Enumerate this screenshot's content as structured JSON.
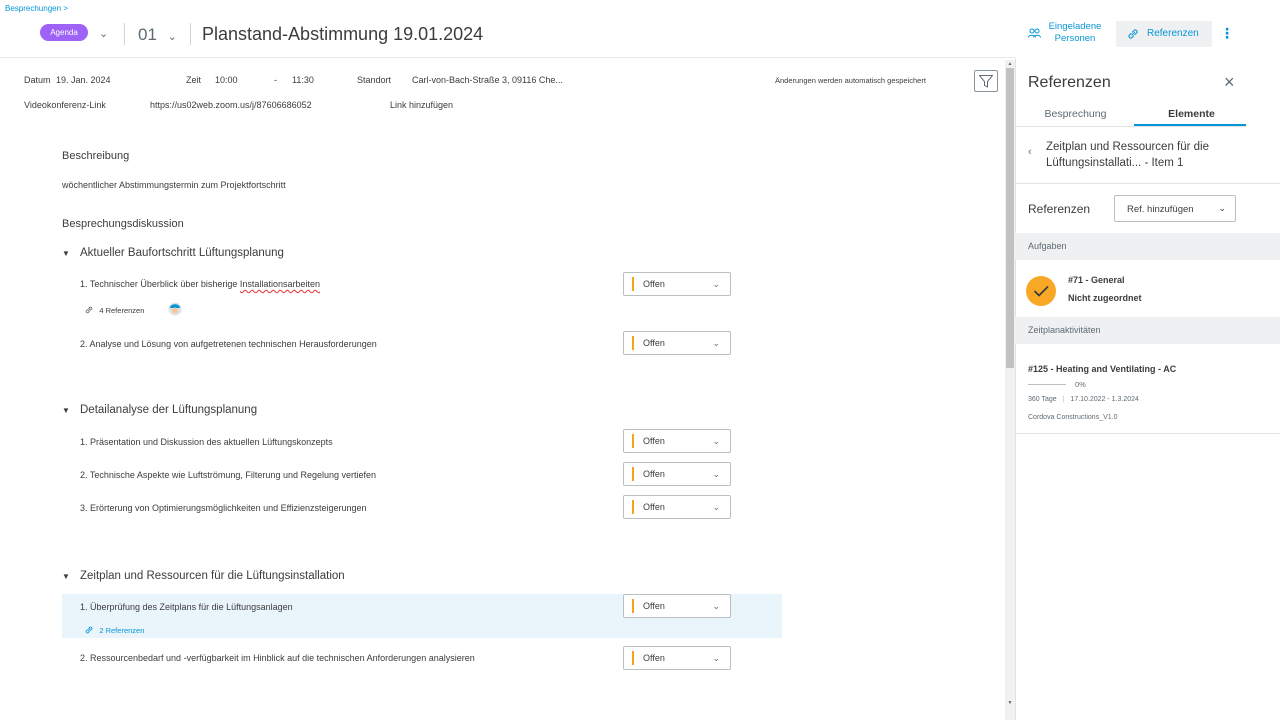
{
  "header": {
    "breadcrumb": "Besprechungen",
    "breadcrumb_chevron": ">",
    "agenda_pill": "Agenda",
    "item_number": "01",
    "title": "Planstand-Abstimmung 19.01.2024",
    "invite_label_1": "Eingeladene",
    "invite_label_2": "Personen",
    "references_label": "Referenzen"
  },
  "meta": {
    "date_label": "Datum",
    "date_value": "19. Jan. 2024",
    "time_label": "Zeit",
    "time_start": "10:00",
    "time_sep": "-",
    "time_end": "11:30",
    "location_label": "Standort",
    "location_value": "Carl-von-Bach-Straße 3, 09116 Che...",
    "autosave": "Änderungen werden automatisch gespeichert",
    "video_label": "Videokonferenz-Link",
    "video_url": "https://us02web.zoom.us/j/87606686052",
    "add_link": "Link hinzufügen"
  },
  "content": {
    "description_heading": "Beschreibung",
    "description_text": "wöchentlicher Abstimmungstermin zum Projektfortschritt",
    "discussion_heading": "Besprechungsdiskussion",
    "groups": [
      {
        "title": "Aktueller Baufortschritt Lüftungsplanung",
        "items": [
          {
            "text_prefix": "1.  Technischer Überblick über bisherige ",
            "text_spell": "Installationsarbeiten",
            "status": "Offen",
            "refs": "4 Referenzen"
          },
          {
            "text": "2.  Analyse und Lösung von aufgetretenen technischen Herausforderungen",
            "status": "Offen"
          }
        ]
      },
      {
        "title": "Detailanalyse der Lüftungsplanung",
        "items": [
          {
            "text": "1.  Präsentation und Diskussion des aktuellen Lüftungskonzepts",
            "status": "Offen"
          },
          {
            "text": "2.  Technische Aspekte wie Luftströmung, Filterung und Regelung vertiefen",
            "status": "Offen"
          },
          {
            "text": "3.  Erörterung von Optimierungsmöglichkeiten und Effizienzsteigerungen",
            "status": "Offen"
          }
        ]
      },
      {
        "title": "Zeitplan und Ressourcen für die Lüftungsinstallation",
        "items": [
          {
            "text": "1.  Überprüfung des Zeitplans für die Lüftungsanlagen",
            "status": "Offen",
            "refs": "2 Referenzen"
          },
          {
            "text": "2.  Ressourcenbedarf und -verfügbarkeit im Hinblick auf die technischen Anforderungen analysieren",
            "status": "Offen"
          }
        ]
      }
    ]
  },
  "panel": {
    "title": "Referenzen",
    "tabs": [
      "Besprechung",
      "Elemente"
    ],
    "active_tab": "Elemente",
    "item_title_1": "Zeitplan und Ressourcen für die",
    "item_title_2": "Lüftungsinstallati... - Item 1",
    "references_label": "Referenzen",
    "add_reference": "Ref. hinzufügen",
    "tasks_heading": "Aufgaben",
    "task_title": "#71 - General",
    "task_status": "Nicht zugeordnet",
    "activities_heading": "Zeitplanaktivitäten",
    "activity_title": "#125 - Heating and Ventilating - AC",
    "activity_progress": "0%",
    "activity_duration": "360 Tage",
    "activity_dates": "17.10.2022 - 1.3.2024",
    "activity_project": "Cordova Constructions_V1.0"
  },
  "colors": {
    "accent": "#0696d7",
    "agenda_pill": "#9e63f6",
    "status_bar": "#faa21b",
    "task_check": "#f9a826",
    "row_highlight": "#e9f4fb"
  }
}
